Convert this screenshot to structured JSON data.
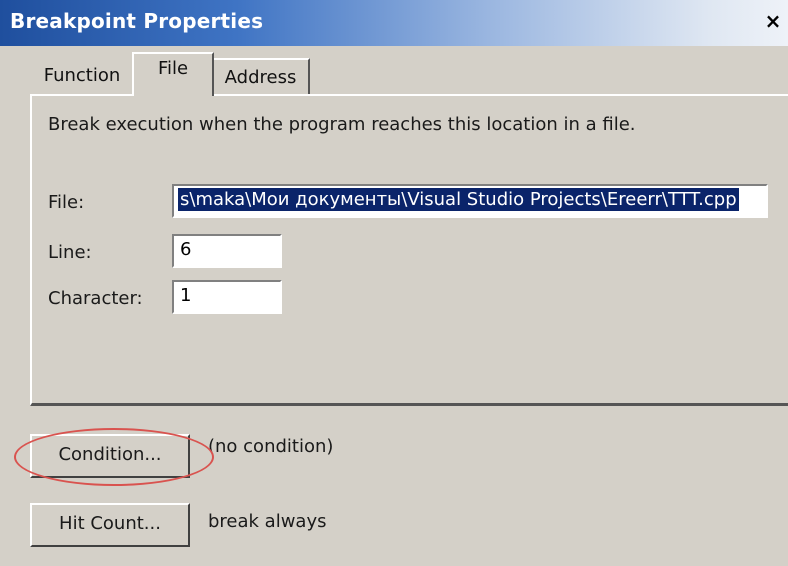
{
  "window": {
    "title": "Breakpoint Properties",
    "close_glyph": "×"
  },
  "tabs": [
    {
      "label": "Function"
    },
    {
      "label": "File"
    },
    {
      "label": "Address"
    }
  ],
  "file_tab": {
    "description": "Break execution when the program reaches this location in a file.",
    "file_label": "File:",
    "file_value": "s\\maka\\Мои документы\\Visual Studio Projects\\Ereerr\\TTT.cpp",
    "line_label": "Line:",
    "line_value": "6",
    "character_label": "Character:",
    "character_value": "1"
  },
  "condition": {
    "button_label": "Condition...",
    "status": "(no condition)"
  },
  "hit_count": {
    "button_label": "Hit Count...",
    "status": "break always"
  },
  "colors": {
    "selection": "#0a246a",
    "annotation": "#d9534f",
    "dialog_bg": "#d4d0c8"
  }
}
